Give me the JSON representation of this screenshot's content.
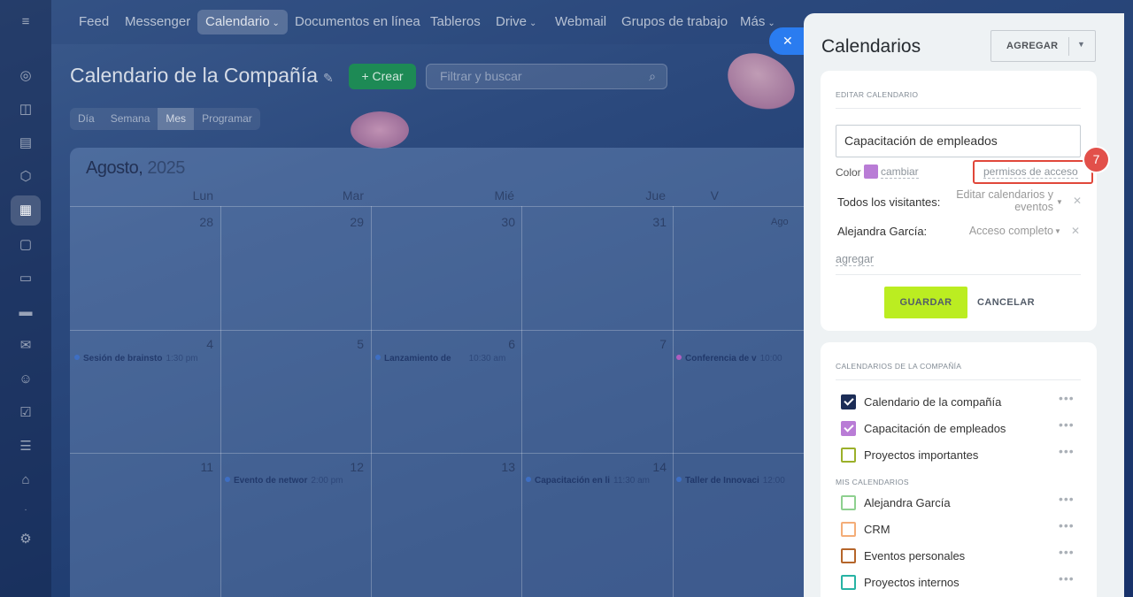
{
  "topnav": {
    "items": [
      {
        "label": "Feed"
      },
      {
        "label": "Messenger"
      },
      {
        "label": "Calendario"
      },
      {
        "label": "Documentos en línea"
      },
      {
        "label": "Tableros"
      },
      {
        "label": "Drive"
      },
      {
        "label": "Webmail"
      },
      {
        "label": "Grupos de trabajo"
      },
      {
        "label": "Más"
      }
    ],
    "active": "Calendario"
  },
  "page": {
    "title": "Calendario de la Compañía",
    "create_label": "+ Crear",
    "search_placeholder": "Filtrar y buscar",
    "views": [
      "Día",
      "Semana",
      "Mes",
      "Programar"
    ],
    "active_view": "Mes"
  },
  "calendar": {
    "month": "Agosto,",
    "year": "2025",
    "weekdays": [
      "Lun",
      "Mar",
      "Mié",
      "Jue",
      "V"
    ],
    "week1": [
      "28",
      "29",
      "30",
      "31",
      "Ago"
    ],
    "week2": [
      "4",
      "5",
      "6",
      "7"
    ],
    "week3": [
      "11",
      "12",
      "13",
      "14"
    ],
    "events": [
      {
        "title": "Sesión de brainsto",
        "time": "1:30 pm",
        "color": "#3e6fc4"
      },
      {
        "title": "Lanzamiento de",
        "time": "10:30 am",
        "color": "#3e6fc4"
      },
      {
        "title": "Conferencia de v",
        "time": "10:00",
        "color": "#b05ec0"
      },
      {
        "title": "Evento de networ",
        "time": "2:00 pm",
        "color": "#3e6fc4"
      },
      {
        "title": "Capacitación en li",
        "time": "11:30 am",
        "color": "#3e6fc4"
      },
      {
        "title": "Taller de Innovaci",
        "time": "12:00",
        "color": "#3e6fc4"
      }
    ]
  },
  "panel": {
    "title": "Calendarios",
    "add_label": "AGREGAR",
    "edit_section": "EDITAR CALENDARIO",
    "calendar_name": "Capacitación de empleados",
    "color_label": "Color",
    "color_value": "#b97cd6",
    "change_label": "cambiar",
    "access_link": "permisos de acceso",
    "step_number": "7",
    "access": [
      {
        "who": "Todos los visitantes:",
        "level_line1": "Editar calendarios y",
        "level_line2": "eventos"
      },
      {
        "who": "Alejandra García:",
        "level_line1": "Acceso completo",
        "level_line2": ""
      }
    ],
    "add_access": "agregar",
    "save_label": "GUARDAR",
    "cancel_label": "CANCELAR",
    "company_section": "CALENDARIOS DE LA COMPAÑÍA",
    "company_calendars": [
      {
        "name": "Calendario de la compañía",
        "color": "#1c2d57",
        "checked": true
      },
      {
        "name": "Capacitación de empleados",
        "color": "#b97cd6",
        "checked": true
      },
      {
        "name": "Proyectos importantes",
        "color": "#9bb02a",
        "checked": false
      }
    ],
    "my_section": "MIS CALENDARIOS",
    "my_calendars": [
      {
        "name": "Alejandra García",
        "color": "#8ed08f",
        "checked": false
      },
      {
        "name": "CRM",
        "color": "#f4ad78",
        "checked": false
      },
      {
        "name": "Eventos personales",
        "color": "#b5652a",
        "checked": false
      },
      {
        "name": "Proyectos internos",
        "color": "#27b3a4",
        "checked": false
      }
    ],
    "more_glyph": "•••"
  }
}
